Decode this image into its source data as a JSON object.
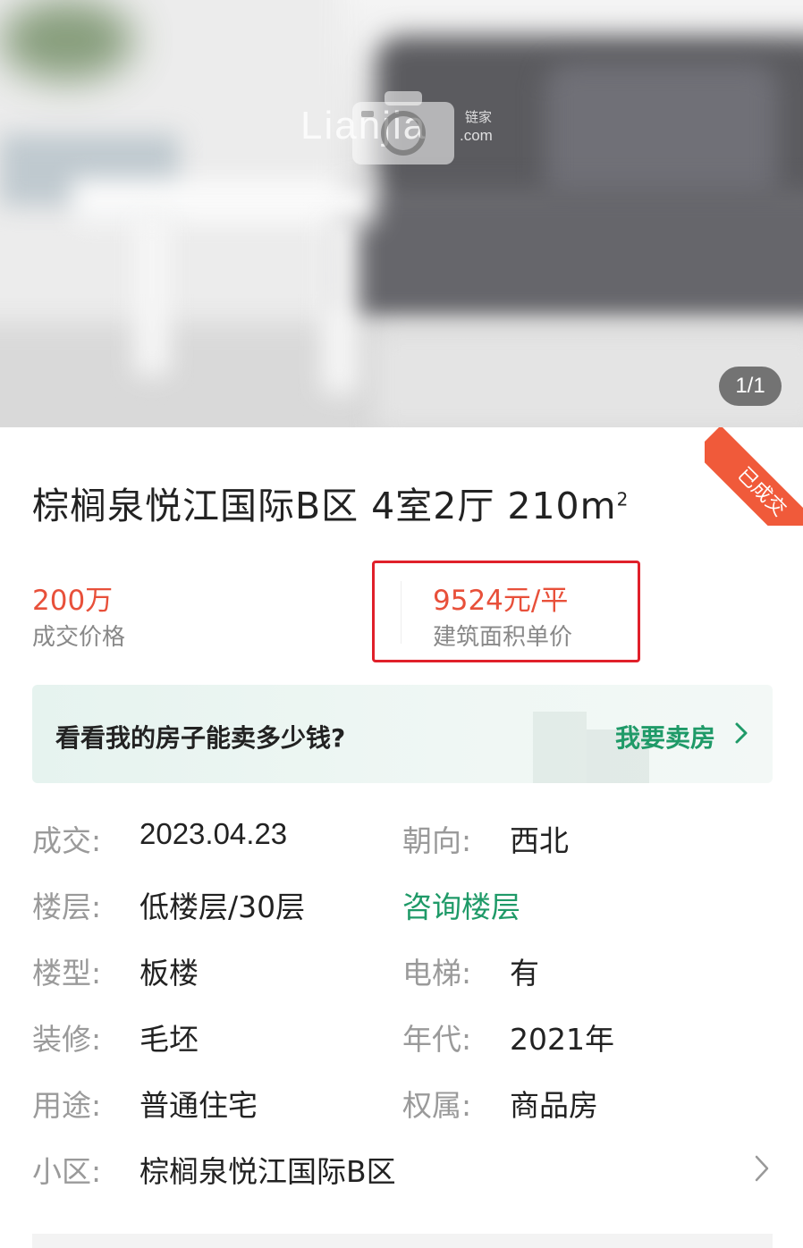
{
  "gallery": {
    "watermark_text": "Lianjia",
    "watermark_cn": "链家",
    "watermark_com": ".com",
    "counter": "1/1"
  },
  "status_ribbon": "已成交",
  "listing": {
    "title": "棕榈泉悦江国际B区 4室2厅 210m",
    "title_sup": "2"
  },
  "prices": {
    "total_value": "200万",
    "total_label": "成交价格",
    "unit_value": "9524元/平",
    "unit_label": "建筑面积单价"
  },
  "promo": {
    "question": "看看我的房子能卖多少钱?",
    "cta": "我要卖房"
  },
  "details": {
    "deal_label": "成交:",
    "deal_value": "2023.04.23",
    "orientation_label": "朝向:",
    "orientation_value": "西北",
    "floor_label": "楼层:",
    "floor_value": "低楼层/30层",
    "floor_consult": "咨询楼层",
    "type_label": "楼型:",
    "type_value": "板楼",
    "elevator_label": "电梯:",
    "elevator_value": "有",
    "decor_label": "装修:",
    "decor_value": "毛坯",
    "year_label": "年代:",
    "year_value": "2021年",
    "usage_label": "用途:",
    "usage_value": "普通住宅",
    "ownership_label": "权属:",
    "ownership_value": "商品房",
    "community_label": "小区:",
    "community_value": "棕榈泉悦江国际B区"
  },
  "colors": {
    "price_red": "#e8503a",
    "accent_green": "#1f9a68",
    "highlight_border": "#e0202a",
    "ribbon": "#f05a3a"
  },
  "icons": [
    "camera-icon",
    "chevron-right-icon"
  ]
}
